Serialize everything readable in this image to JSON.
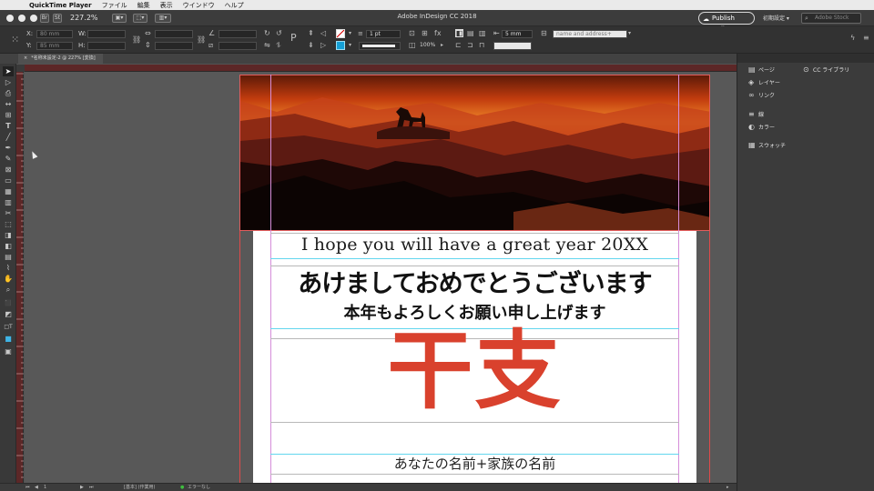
{
  "menubar": {
    "apple": "",
    "app_name": "QuickTime Player",
    "items": [
      "ファイル",
      "編集",
      "表示",
      "ウインドウ",
      "ヘルプ"
    ]
  },
  "appbar": {
    "title": "Adobe InDesign CC 2018",
    "zoom": "227.2%",
    "br_label": "Br",
    "st_label": "St",
    "publish_label": "Publish Online",
    "workspace": "初期設定",
    "search_placeholder": "Adobe Stock"
  },
  "control": {
    "x_label": "X:",
    "x_value": "80 mm",
    "y_label": "Y:",
    "y_value": "85 mm",
    "w_label": "W:",
    "h_label": "H:",
    "stroke_weight": "1 pt",
    "opacity": "100%",
    "gap_value": "5 mm",
    "object_style": "name and address+"
  },
  "tab": {
    "title": "*名称未設定-2 @ 227% [変換]",
    "close": "×"
  },
  "document": {
    "greeting_en": "I hope you will have a great year 20XX",
    "greeting_jp1": "あけましておめでとうございます",
    "greeting_jp2": "本年もよろしくお願い申し上げます",
    "eto": "干支",
    "names": "あなたの名前+家族の名前"
  },
  "panels": {
    "items": [
      {
        "icon": "pages-icon",
        "glyph": "▤",
        "label": "ページ"
      },
      {
        "icon": "layers-icon",
        "glyph": "◈",
        "label": "レイヤー"
      },
      {
        "icon": "links-icon",
        "glyph": "∞",
        "label": "リンク"
      },
      {
        "icon": "stroke-icon",
        "glyph": "≡",
        "label": "線"
      },
      {
        "icon": "color-icon",
        "glyph": "◐",
        "label": "カラー"
      },
      {
        "icon": "swatches-icon",
        "glyph": "▦",
        "label": "スウォッチ"
      }
    ],
    "cc_libraries": {
      "icon": "cc-libraries-icon",
      "glyph": "⊙",
      "label": "CC ライブラリ"
    }
  },
  "status": {
    "page": "1",
    "profile": "[基本] (作業用)",
    "errors": "エラーなし"
  },
  "colors": {
    "eto_red": "#d9412d",
    "bleed_red": "#e04a4a",
    "guide_cyan": "#63d6ee",
    "ui_dark": "#3b3b3b"
  }
}
